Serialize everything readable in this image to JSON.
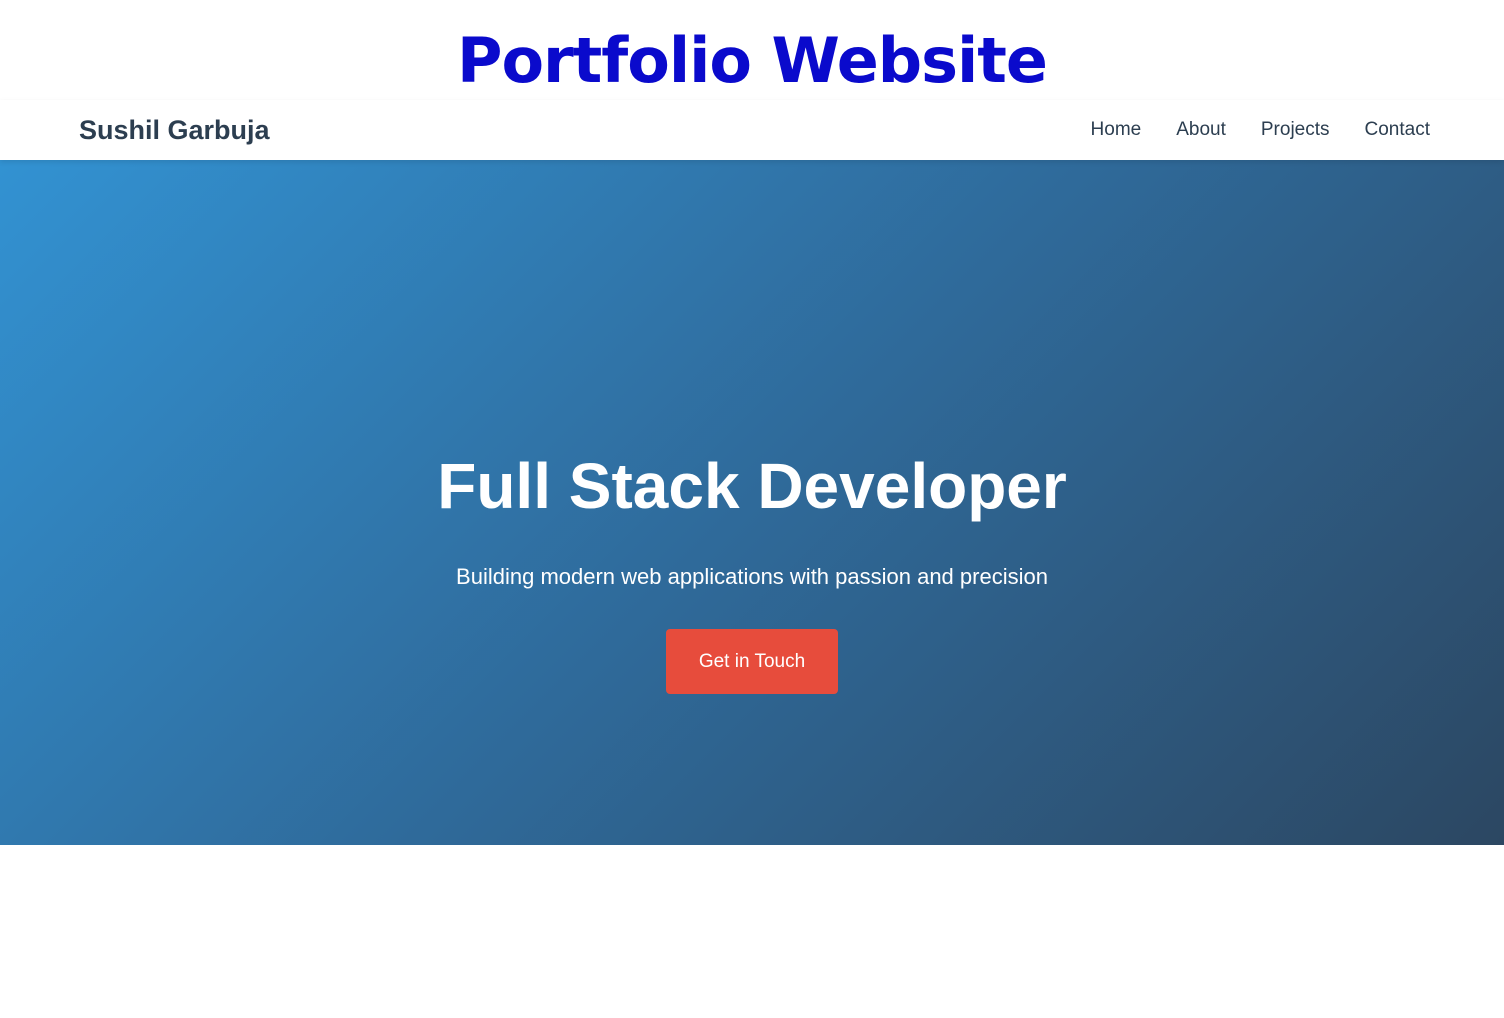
{
  "banner": {
    "title": "Portfolio Website"
  },
  "navbar": {
    "brand": "Sushil Garbuja",
    "links": [
      {
        "label": "Home"
      },
      {
        "label": "About"
      },
      {
        "label": "Projects"
      },
      {
        "label": "Contact"
      }
    ]
  },
  "hero": {
    "title": "Full Stack Developer",
    "subtitle": "Building modern web applications with passion and precision",
    "cta_label": "Get in Touch"
  },
  "colors": {
    "banner_text": "#0a0acc",
    "brand_text": "#2c3e50",
    "hero_gradient_start": "#3292d2",
    "hero_gradient_end": "#2c4762",
    "cta_background": "#e74c3c"
  }
}
